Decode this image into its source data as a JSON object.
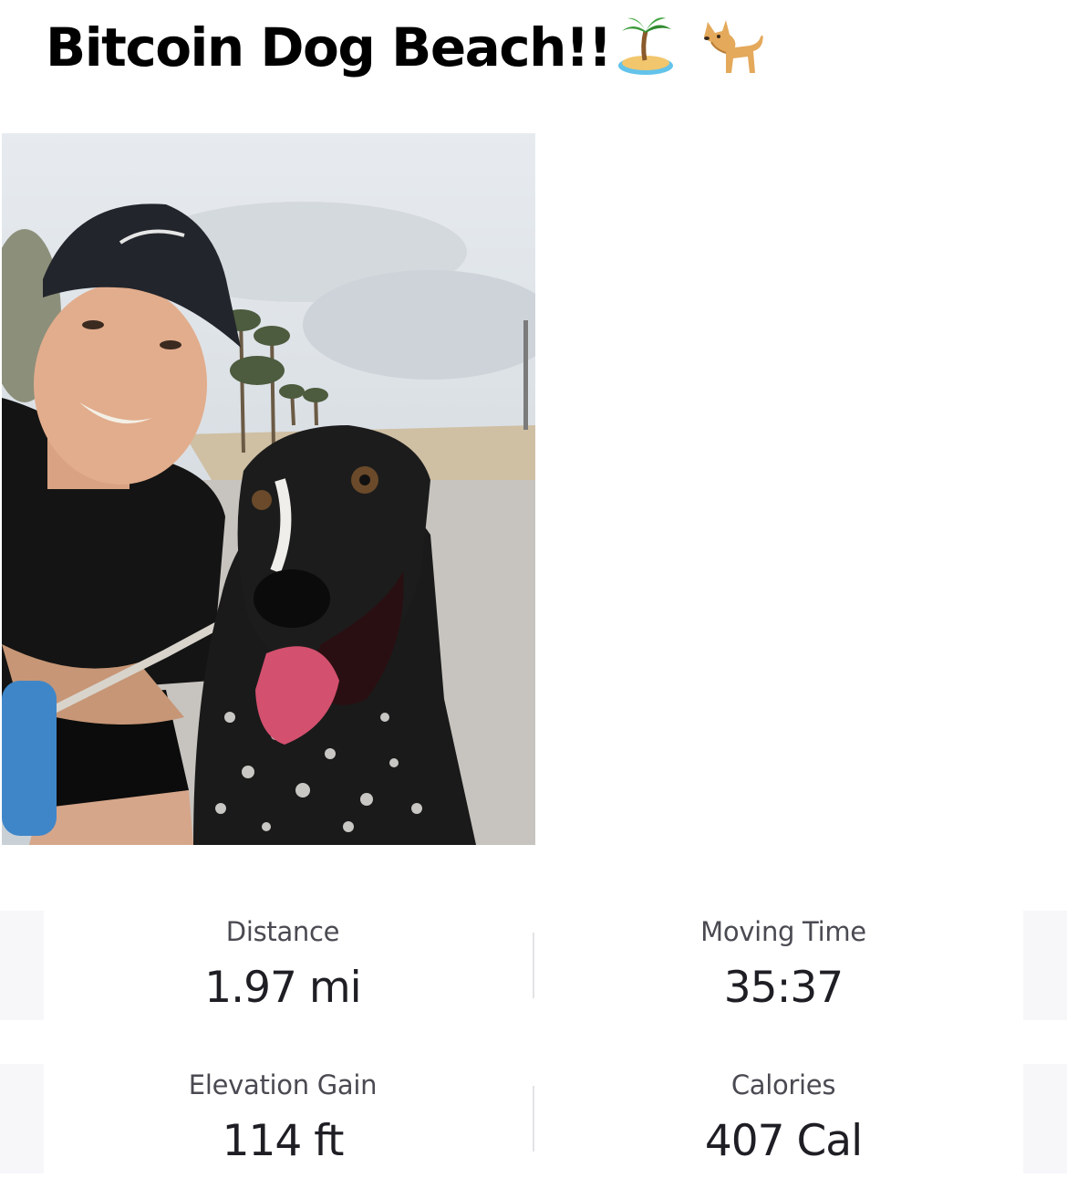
{
  "activity": {
    "title": "Bitcoin Dog Beach!!",
    "title_emojis": [
      "desert-island-icon",
      "dog-icon"
    ]
  },
  "photo": {
    "subject": "selfie-photo"
  },
  "stats": [
    {
      "label": "Distance",
      "value": "1.97 mi"
    },
    {
      "label": "Moving Time",
      "value": "35:37"
    },
    {
      "label": "Elevation Gain",
      "value": "114 ft"
    },
    {
      "label": "Calories",
      "value": "407 Cal"
    }
  ],
  "colors": {
    "label": "#4a4a52",
    "value": "#1e1e24",
    "panel_side": "#f7f7fa",
    "divider": "#e3e3e6"
  }
}
